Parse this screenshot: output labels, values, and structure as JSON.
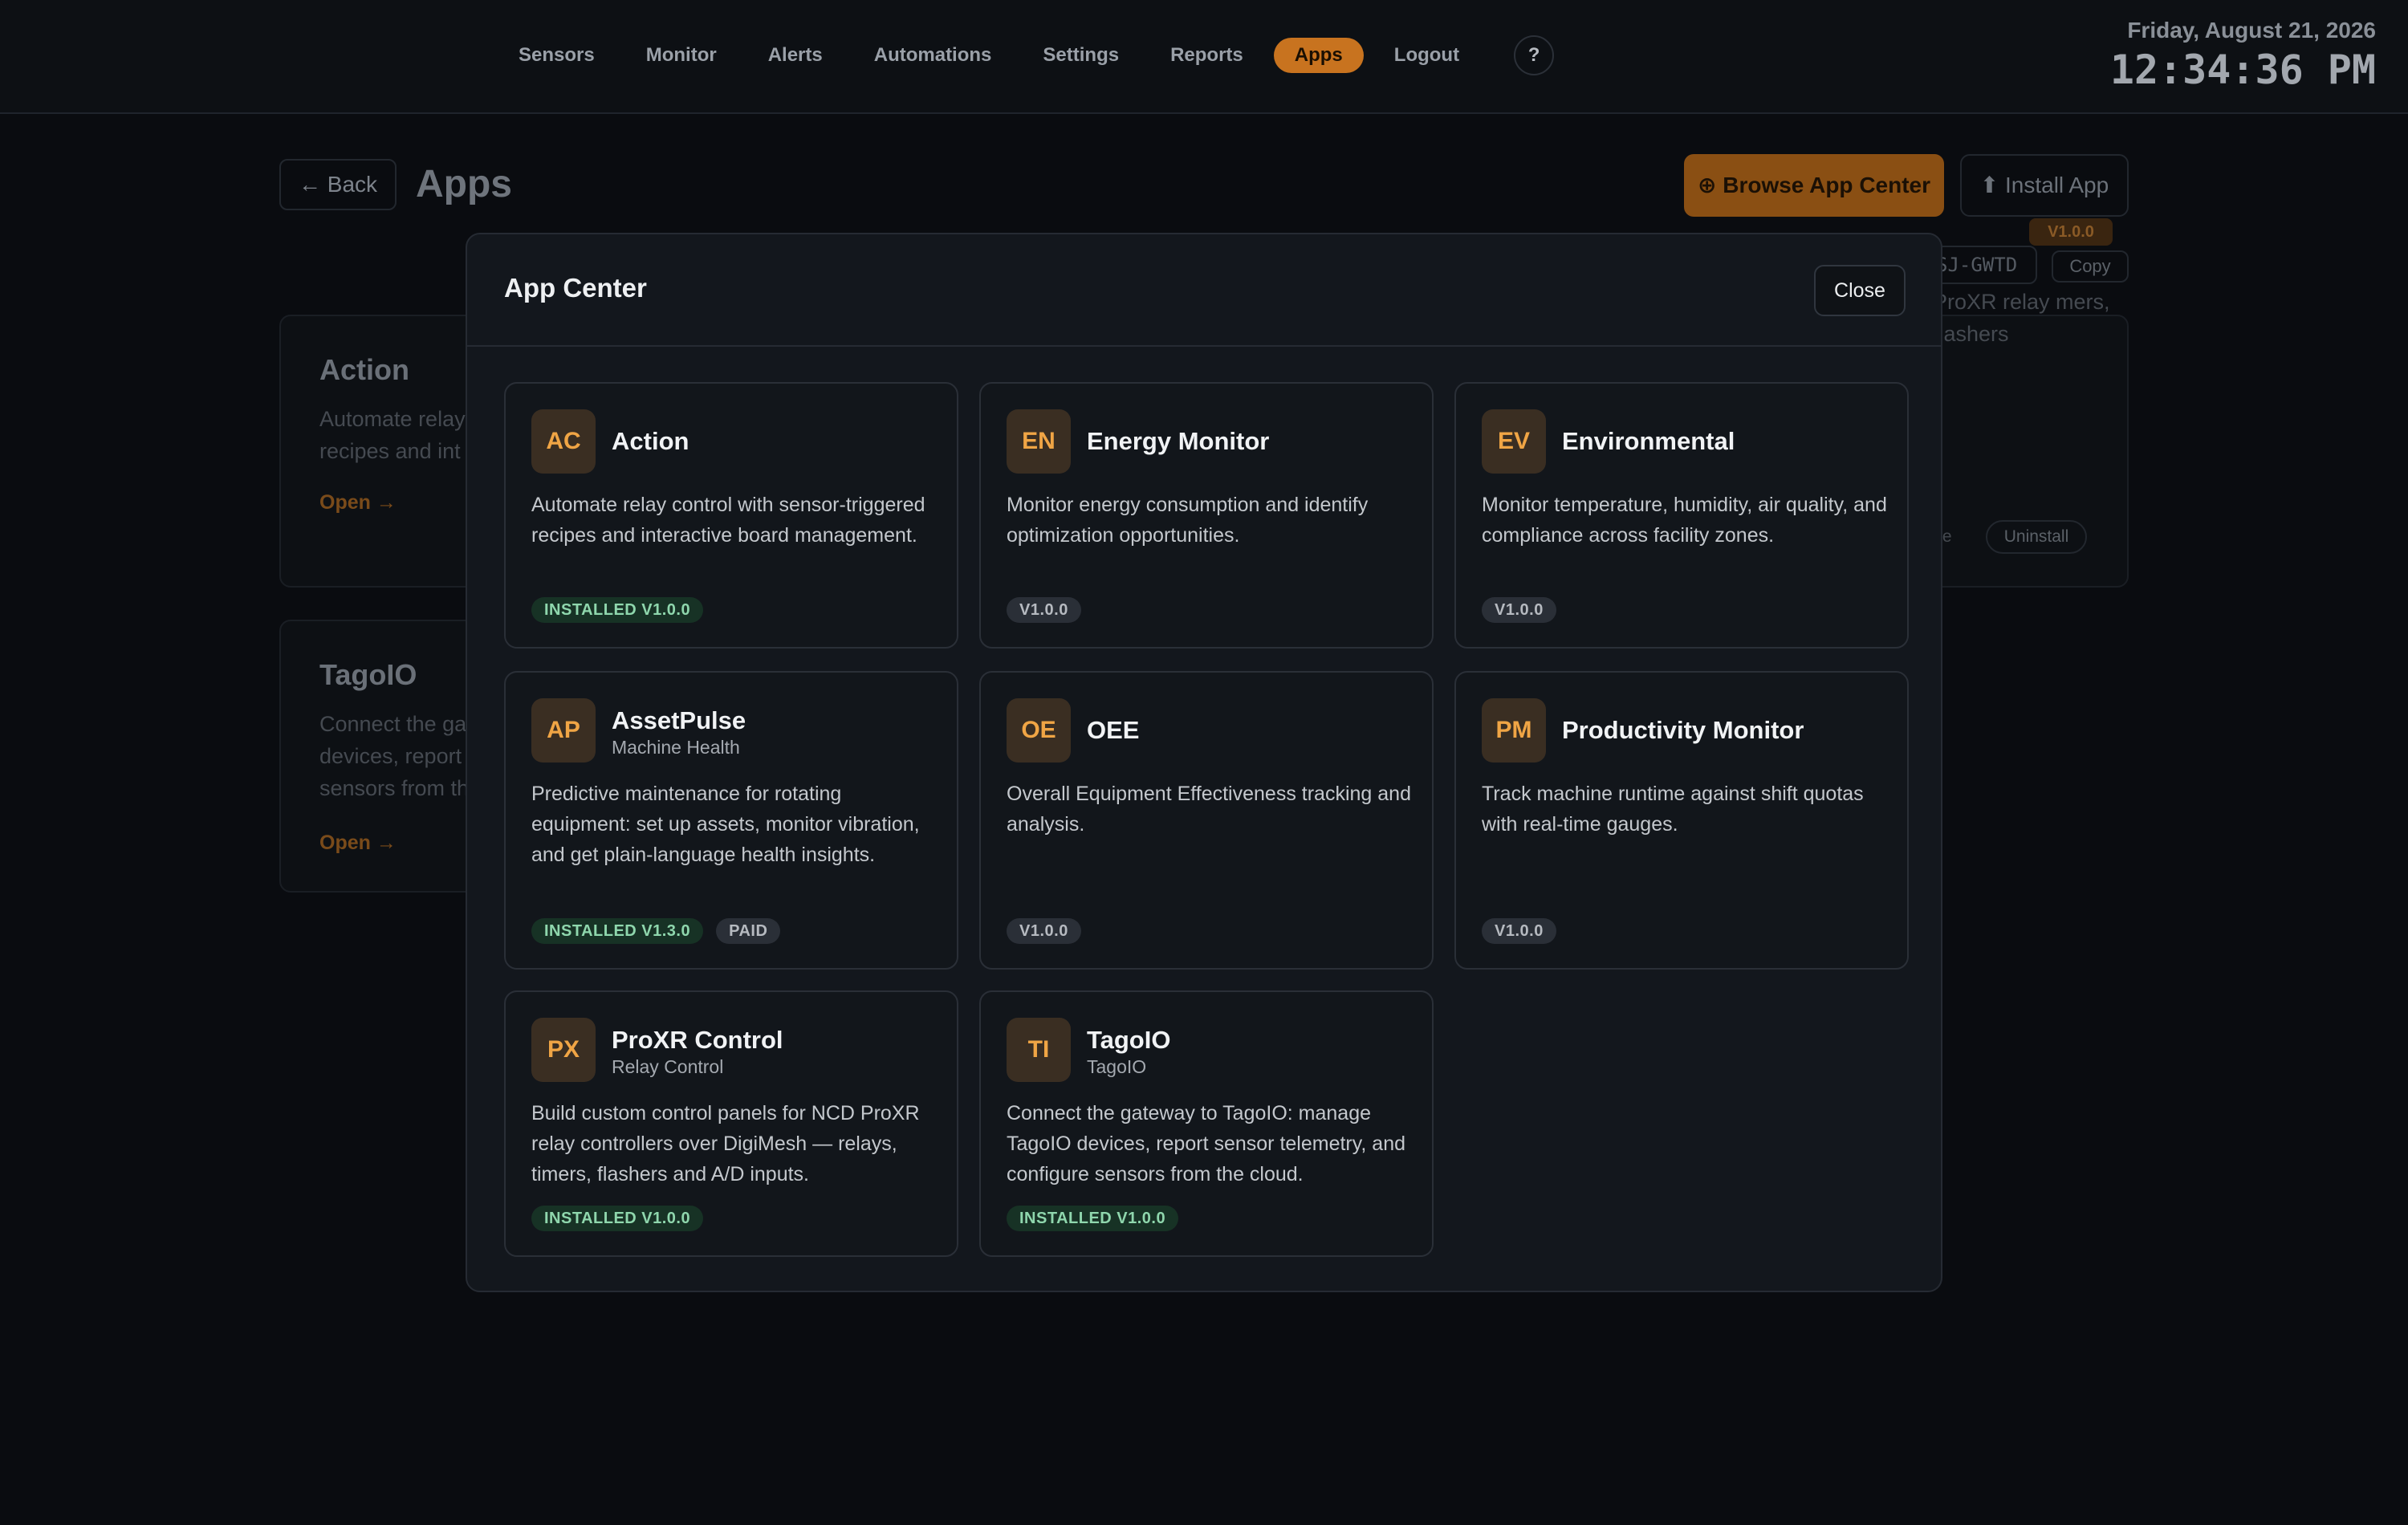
{
  "nav": {
    "items": [
      {
        "label": "Sensors",
        "active": false
      },
      {
        "label": "Monitor",
        "active": false
      },
      {
        "label": "Alerts",
        "active": false
      },
      {
        "label": "Automations",
        "active": false
      },
      {
        "label": "Settings",
        "active": false
      },
      {
        "label": "Reports",
        "active": false
      },
      {
        "label": "Apps",
        "active": true
      },
      {
        "label": "Logout",
        "active": false
      }
    ],
    "help_label": "?"
  },
  "clock": {
    "date": "Friday, August 21, 2026",
    "time": "12:34:36 PM"
  },
  "page": {
    "back_label": "← Back",
    "title": "Apps",
    "browse_label": "⊕ Browse App Center",
    "install_label": "⬆ Install App",
    "code_fragment": "SJ-GWTD",
    "copy_label": "Copy",
    "cards": [
      {
        "title": "Action",
        "desc": "Automate relay recipes and int",
        "open_label": "Open →"
      },
      {
        "title": "TagoIO",
        "desc": "Connect the ga devices, report sensors from th",
        "open_label": "Open →"
      }
    ],
    "right_card": {
      "badge": "V1.0.0",
      "desc": "ProXR relay mers, flashers",
      "small_label": "te",
      "uninstall_label": "Uninstall"
    }
  },
  "modal": {
    "title": "App Center",
    "close_label": "Close",
    "apps": [
      {
        "abbr": "AC",
        "name": "Action",
        "subtitle": "",
        "description": "Automate relay control with sensor-triggered recipes and interactive board management.",
        "badges": [
          {
            "text": "INSTALLED V1.0.0",
            "kind": "installed"
          }
        ]
      },
      {
        "abbr": "EN",
        "name": "Energy Monitor",
        "subtitle": "",
        "description": "Monitor energy consumption and identify optimization opportunities.",
        "badges": [
          {
            "text": "V1.0.0",
            "kind": "version"
          }
        ]
      },
      {
        "abbr": "EV",
        "name": "Environmental",
        "subtitle": "",
        "description": "Monitor temperature, humidity, air quality, and compliance across facility zones.",
        "badges": [
          {
            "text": "V1.0.0",
            "kind": "version"
          }
        ]
      },
      {
        "abbr": "AP",
        "name": "AssetPulse",
        "subtitle": "Machine Health",
        "description": "Predictive maintenance for rotating equipment: set up assets, monitor vibration, and get plain-language health insights.",
        "badges": [
          {
            "text": "INSTALLED V1.3.0",
            "kind": "installed"
          },
          {
            "text": "PAID",
            "kind": "paid"
          }
        ]
      },
      {
        "abbr": "OE",
        "name": "OEE",
        "subtitle": "",
        "description": "Overall Equipment Effectiveness tracking and analysis.",
        "badges": [
          {
            "text": "V1.0.0",
            "kind": "version"
          }
        ]
      },
      {
        "abbr": "PM",
        "name": "Productivity Monitor",
        "subtitle": "",
        "description": "Track machine runtime against shift quotas with real-time gauges.",
        "badges": [
          {
            "text": "V1.0.0",
            "kind": "version"
          }
        ]
      },
      {
        "abbr": "PX",
        "name": "ProXR Control",
        "subtitle": "Relay Control",
        "description": "Build custom control panels for NCD ProXR relay controllers over DigiMesh — relays, timers, flashers and A/D inputs.",
        "badges": [
          {
            "text": "INSTALLED V1.0.0",
            "kind": "installed"
          }
        ]
      },
      {
        "abbr": "TI",
        "name": "TagoIO",
        "subtitle": "TagoIO",
        "description": "Connect the gateway to TagoIO: manage TagoIO devices, report sensor telemetry, and configure sensors from the cloud.",
        "badges": [
          {
            "text": "INSTALLED V1.0.0",
            "kind": "installed"
          }
        ]
      }
    ]
  },
  "colors": {
    "accent": "#c8731f",
    "installed_badge_bg": "#173225",
    "installed_badge_text": "#8fd7ad",
    "icon_tile_bg": "#3a2e22",
    "icon_tile_text": "#f0a545"
  }
}
